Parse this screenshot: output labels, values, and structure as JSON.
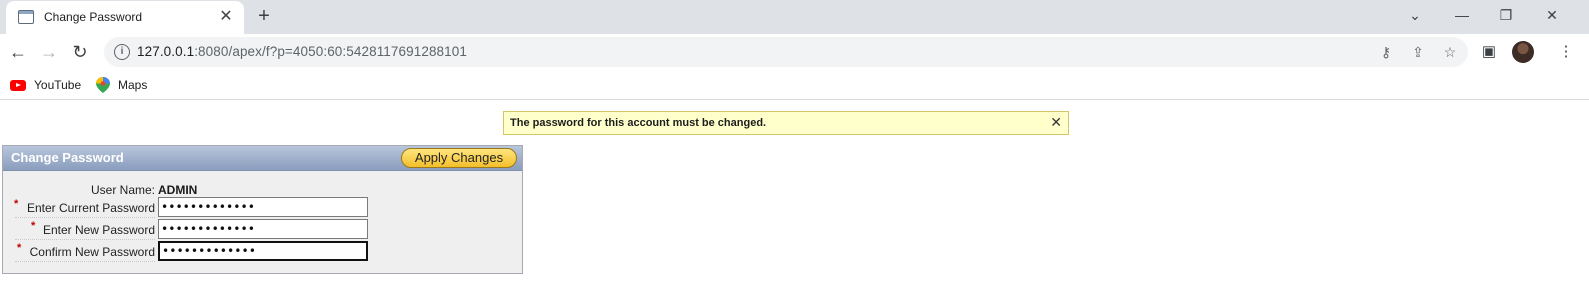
{
  "browser": {
    "tab_title": "Change Password",
    "url_host": "127.0.0.1",
    "url_rest": ":8080/apex/f?p=4050:60:5428117691288101",
    "bookmarks": [
      {
        "label": "YouTube",
        "icon": "youtube-icon"
      },
      {
        "label": "Maps",
        "icon": "maps-icon"
      }
    ]
  },
  "message": {
    "text": "The password for this account must be changed.",
    "close_glyph": "✕"
  },
  "region": {
    "title": "Change Password",
    "apply_label": "Apply Changes"
  },
  "form": {
    "user_name_label": "User Name:",
    "user_name_value": "ADMIN",
    "required_marker": "*",
    "fields": [
      {
        "label": "Enter Current Password",
        "value": "•••••••••••••"
      },
      {
        "label": "Enter New Password",
        "value": "•••••••••••••"
      },
      {
        "label": "Confirm New Password",
        "value": "•••••••••••••"
      }
    ]
  },
  "colors": {
    "message_bg": "#ffffcc",
    "region_header": "#8a9dbd",
    "apply_button": "#f3bf2b",
    "required": "#c00000"
  }
}
